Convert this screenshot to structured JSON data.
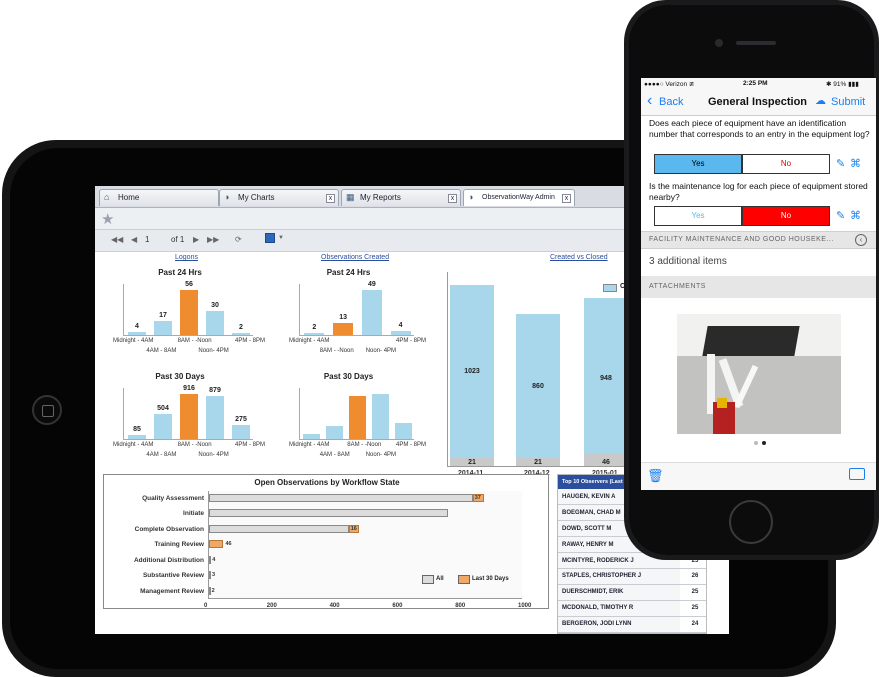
{
  "tablet": {
    "tabs": [
      {
        "label": "Home",
        "icon": "home-icon"
      },
      {
        "label": "My Charts",
        "icon": "chart-icon"
      },
      {
        "label": "My Reports",
        "icon": "report-icon"
      },
      {
        "label": "ObservationWay Admin",
        "icon": "chart-icon"
      }
    ],
    "pager": {
      "page": "1",
      "of": "of 1"
    },
    "links": {
      "logons": "Logons",
      "observations_created": "Observations Created",
      "created_vs_closed": "Created vs Closed"
    },
    "mini_charts": [
      {
        "title": "Past 24 Hrs",
        "values": [
          4,
          17,
          56,
          30,
          2
        ],
        "colors": [
          "blue",
          "blue",
          "orange",
          "blue",
          "blue"
        ],
        "ticks_top": [
          "Midnight - 4AM",
          "8AM - -Noon",
          "4PM - 8PM"
        ],
        "ticks_bottom": [
          "4AM - 8AM",
          "Noon- 4PM"
        ]
      },
      {
        "title": "Past 24 Hrs",
        "values": [
          2,
          13,
          49,
          4
        ],
        "colors": [
          "blue",
          "orange",
          "blue",
          "blue"
        ],
        "ticks_top": [
          "Midnight - 4AM",
          "4PM - 8PM"
        ],
        "ticks_bottom": [
          "8AM - -Noon",
          "Noon- 4PM"
        ]
      },
      {
        "title": "Past 30 Days",
        "values": [
          85,
          504,
          916,
          879,
          275
        ],
        "colors": [
          "blue",
          "blue",
          "orange",
          "blue",
          "blue"
        ],
        "ticks_top": [
          "Midnight - 4AM",
          "8AM - -Noon",
          "4PM - 8PM"
        ],
        "ticks_bottom": [
          "4AM - 8AM",
          "Noon- 4PM"
        ]
      },
      {
        "title": "Past 30 Days",
        "values": [
          60,
          140,
          480,
          500,
          180
        ],
        "colors": [
          "blue",
          "blue",
          "orange",
          "blue",
          "blue"
        ],
        "ticks_top": [
          "Midnight - 4AM",
          "8AM - -Noon",
          "4PM - 8PM"
        ],
        "ticks_bottom": [
          "4AM - 8AM",
          "Noon- 4PM"
        ]
      }
    ],
    "created_vs_closed": {
      "categories": [
        "2014-11",
        "2014-12",
        "2015-01"
      ],
      "created": [
        1023,
        860,
        948
      ],
      "closed": [
        21,
        21,
        46
      ],
      "legend": "C"
    },
    "workflow_chart": {
      "title": "Open Observations by Workflow State",
      "rows": [
        {
          "label": "Quality Assessment",
          "all": 840,
          "last30": 37
        },
        {
          "label": "Initiate",
          "all": 760,
          "last30": 0
        },
        {
          "label": "Complete Observation",
          "all": 445,
          "last30": 16
        },
        {
          "label": "Training Review",
          "all": 0,
          "last30": 46
        },
        {
          "label": "Additional Distribution",
          "all": 4,
          "last30": 0
        },
        {
          "label": "Substantive Review",
          "all": 3,
          "last30": 0
        },
        {
          "label": "Management Review",
          "all": 2,
          "last30": 0
        }
      ],
      "labels_shown": [
        "37",
        "",
        "16",
        "46",
        "4",
        "3",
        "2"
      ],
      "x_ticks": [
        "0",
        "200",
        "400",
        "600",
        "800",
        "1000"
      ],
      "legend": {
        "all": "All",
        "last30": "Last 30 Days"
      },
      "colors": {
        "all": "#dcdcdc",
        "last30": "#f0a868"
      }
    },
    "observers": {
      "header": "Top 10 Observers (Last",
      "rows": [
        {
          "name": "HAUGEN, KEVIN A",
          "count": ""
        },
        {
          "name": "BOEGMAN, CHAD M",
          "count": ""
        },
        {
          "name": "DOWD, SCOTT M",
          "count": ""
        },
        {
          "name": "RAWAY, HENRY M",
          "count": ""
        },
        {
          "name": "MCINTYRE, RODERICK J",
          "count": "25"
        },
        {
          "name": "STAPLES, CHRISTOPHER J",
          "count": "26"
        },
        {
          "name": "DUERSCHMIDT, ERIK",
          "count": "25"
        },
        {
          "name": "MCDONALD, TIMOTHY R",
          "count": "25"
        },
        {
          "name": "BERGERON, JODI LYNN",
          "count": "24"
        }
      ]
    }
  },
  "phone": {
    "status": {
      "carrier": "●●●●○ Verizon ≇",
      "time": "2:25 PM",
      "battery": "✱ 91% ▮▮▮"
    },
    "nav": {
      "back": "Back",
      "title": "General Inspection",
      "submit": "Submit"
    },
    "q1": "Does each piece of equipment have an identification number that corresponds to an entry in the equipment log?",
    "q2": "Is the maintenance log for each piece of equipment stored nearby?",
    "yes": "Yes",
    "no": "No",
    "section": "FACILITY MAINTENANCE AND GOOD HOUSEKE...",
    "additional": "3 additional items",
    "attachments": "ATTACHMENTS",
    "colors": {
      "yes_selected": "#5bb8ee",
      "no_selected": "#ff0000",
      "link": "#1a7ff2"
    }
  }
}
